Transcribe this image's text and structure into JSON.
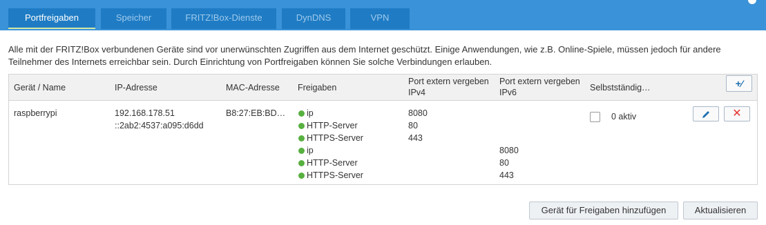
{
  "tabs": [
    {
      "label": "Portfreigaben",
      "active": true
    },
    {
      "label": "Speicher",
      "active": false
    },
    {
      "label": "FRITZ!Box-Dienste",
      "active": false
    },
    {
      "label": "DynDNS",
      "active": false
    },
    {
      "label": "VPN",
      "active": false
    }
  ],
  "intro": "Alle mit der FRITZ!Box verbundenen Geräte sind vor unerwünschten Zugriffen aus dem Internet geschützt. Einige Anwendungen, wie z.B. Online-Spiele, müssen jedoch für andere Teilnehmer des Internets erreichbar sein. Durch Einrichtung von Portfreigaben können Sie solche Verbindungen erlauben.",
  "table": {
    "headers": {
      "device": "Gerät / Name",
      "ip": "IP-Adresse",
      "mac": "MAC-Adresse",
      "shares": "Freigaben",
      "port_v4": "Port extern vergeben IPv4",
      "port_v6": "Port extern vergeben IPv6",
      "self": "Selbstständig…"
    },
    "add_icon": "plus-minus-icon",
    "row": {
      "device": "raspberrypi",
      "ipv4": "192.168.178.51",
      "ipv6": "::2ab2:4537:a095:d6dd",
      "mac": "B8:27:EB:BD…",
      "rules": [
        {
          "name": "ip",
          "port_v4": "8080",
          "port_v6": ""
        },
        {
          "name": "HTTP-Server",
          "port_v4": "80",
          "port_v6": ""
        },
        {
          "name": "HTTPS-Server",
          "port_v4": "443",
          "port_v6": ""
        },
        {
          "name": "ip",
          "port_v4": "",
          "port_v6": "8080"
        },
        {
          "name": "HTTP-Server",
          "port_v4": "",
          "port_v6": "80"
        },
        {
          "name": "HTTPS-Server",
          "port_v4": "",
          "port_v6": "443"
        }
      ],
      "self_checked": false,
      "self_label": "0 aktiv"
    }
  },
  "buttons": {
    "add_device": "Gerät für Freigaben hinzufügen",
    "refresh": "Aktualisieren"
  },
  "colors": {
    "tabbar": "#3a92d8",
    "tab": "#1f7cc4",
    "active_underline": "#d6e8a4",
    "status_dot": "#58b040",
    "delete": "#e3342f",
    "edit": "#1f6fb0"
  }
}
